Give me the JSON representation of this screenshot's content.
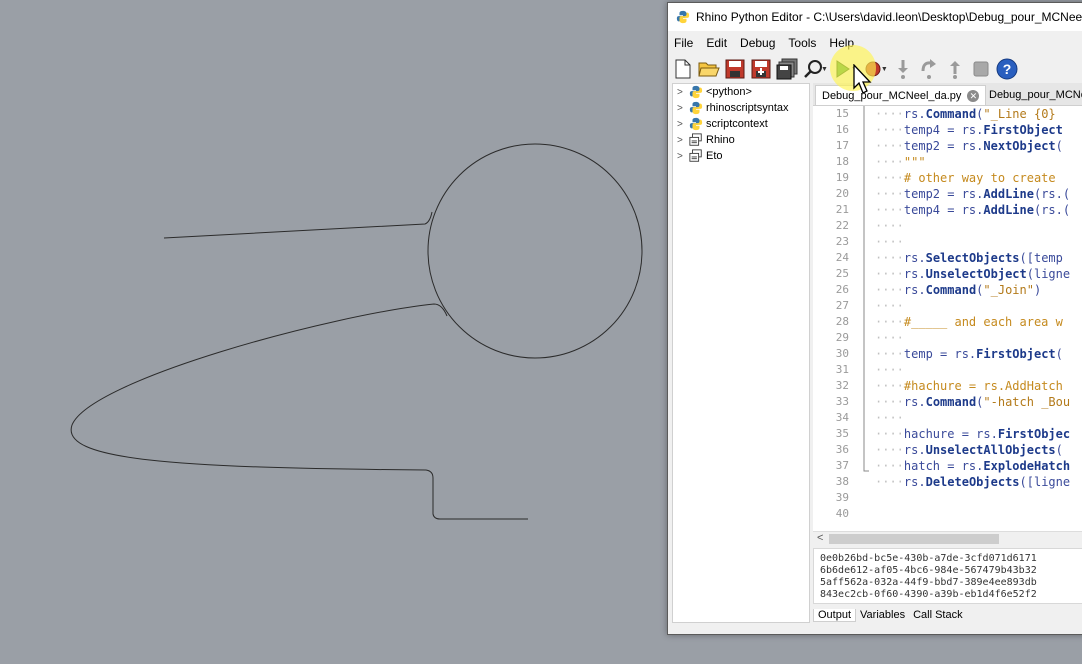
{
  "window": {
    "title": "Rhino Python Editor - C:\\Users\\david.leon\\Desktop\\Debug_pour_MCNeel"
  },
  "menu": [
    "File",
    "Edit",
    "Debug",
    "Tools",
    "Help"
  ],
  "toolbar": {
    "icons": [
      "new-file-icon",
      "open-folder-icon",
      "save-icon",
      "save-as-icon",
      "save-all-icon",
      "find-icon",
      "run-icon",
      "breakpoint-icon",
      "step-into-icon",
      "step-over-icon",
      "step-out-icon",
      "stop-icon",
      "help-icon"
    ]
  },
  "tree": {
    "items": [
      {
        "label": "<python>",
        "icon": "python-icon"
      },
      {
        "label": "rhinoscriptsyntax",
        "icon": "python-icon"
      },
      {
        "label": "scriptcontext",
        "icon": "python-icon"
      },
      {
        "label": "Rhino",
        "icon": "namespace-icon"
      },
      {
        "label": "Eto",
        "icon": "namespace-icon"
      }
    ]
  },
  "tabs": [
    {
      "label": "Debug_pour_MCNeel_da.py",
      "active": true
    },
    {
      "label": "Debug_pour_MCNe",
      "active": false
    }
  ],
  "code": {
    "lines": [
      {
        "n": "15",
        "t": "    rs.Command(\"_Line {0}"
      },
      {
        "n": "16",
        "t": "    temp4 = rs.FirstObject"
      },
      {
        "n": "17",
        "t": "    temp2 = rs.NextObject("
      },
      {
        "n": "18",
        "t": "    \"\"\""
      },
      {
        "n": "19",
        "t": "    # other way to create"
      },
      {
        "n": "20",
        "t": "    temp2 = rs.AddLine(rs.("
      },
      {
        "n": "21",
        "t": "    temp4 = rs.AddLine(rs.("
      },
      {
        "n": "22",
        "t": "    "
      },
      {
        "n": "23",
        "t": "    "
      },
      {
        "n": "24",
        "t": "    rs.SelectObjects([temp"
      },
      {
        "n": "25",
        "t": "    rs.UnselectObject(ligne"
      },
      {
        "n": "26",
        "t": "    rs.Command(\"_Join\")"
      },
      {
        "n": "27",
        "t": "    "
      },
      {
        "n": "28",
        "t": "    #_____ and each area w"
      },
      {
        "n": "29",
        "t": "    "
      },
      {
        "n": "30",
        "t": "    temp = rs.FirstObject("
      },
      {
        "n": "31",
        "t": "    "
      },
      {
        "n": "32",
        "t": "    #hachure = rs.AddHatch"
      },
      {
        "n": "33",
        "t": "    rs.Command(\"-hatch _Bou"
      },
      {
        "n": "34",
        "t": "    "
      },
      {
        "n": "35",
        "t": "    hachure = rs.FirstObjec"
      },
      {
        "n": "36",
        "t": "    rs.UnselectAllObjects("
      },
      {
        "n": "37",
        "t": "    hatch = rs.ExplodeHatch"
      },
      {
        "n": "38",
        "t": "    rs.DeleteObjects([ligne"
      },
      {
        "n": "39",
        "t": ""
      },
      {
        "n": "40",
        "t": ""
      }
    ]
  },
  "output": {
    "lines": [
      "0e0b26bd-bc5e-430b-a7de-3cfd071d6171",
      "6b6de612-af05-4bc6-984e-567479b43b32",
      "5aff562a-032a-44f9-bbd7-389e4ee893db",
      "843ec2cb-0f60-4390-a39b-eb1d4f6e52f2"
    ],
    "tabs": [
      "Output",
      "Variables",
      "Call Stack"
    ]
  },
  "colors": {
    "viewport_bg": "#9a9fa6",
    "curve": "#2a2a2a",
    "python_blue": "#3776ab",
    "python_yellow": "#ffd43b"
  }
}
